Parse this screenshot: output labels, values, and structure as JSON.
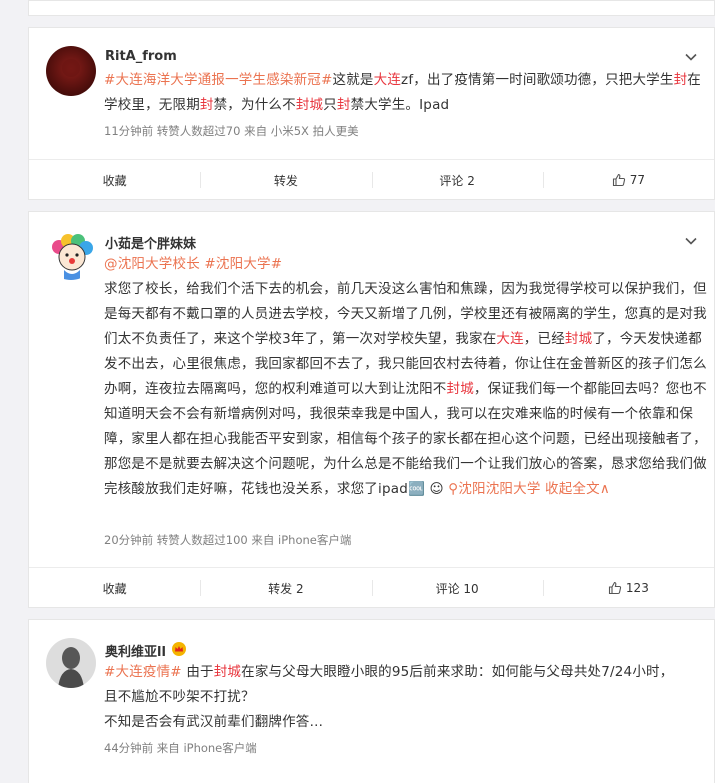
{
  "posts": [
    {
      "username": "RitA_from",
      "segments": [
        {
          "t": "#大连海洋大学通报一学生感染新冠#",
          "c": "topic"
        },
        {
          "t": "这就是",
          "c": ""
        },
        {
          "t": "大连",
          "c": "hl"
        },
        {
          "t": "zf，出了疫情第一时间歌颂功德，只把大学生",
          "c": ""
        },
        {
          "t": "封",
          "c": "hl"
        },
        {
          "t": "在学校里，无限期",
          "c": ""
        },
        {
          "t": "封",
          "c": "hl"
        },
        {
          "t": "禁，为什么不",
          "c": ""
        },
        {
          "t": "封城",
          "c": "hl"
        },
        {
          "t": "只",
          "c": ""
        },
        {
          "t": "封",
          "c": "hl"
        },
        {
          "t": "禁大学生。Ipad",
          "c": ""
        }
      ],
      "meta": "11分钟前 转赞人数超过70  来自 小米5X 拍人更美",
      "actions": {
        "collect": "收藏",
        "repost": "转发",
        "comment": "评论 2",
        "like": "77"
      }
    },
    {
      "username": "小茹是个胖妹妹",
      "segments": [
        {
          "t": "@沈阳大学校长",
          "c": "link"
        },
        {
          "t": " ",
          "c": ""
        },
        {
          "t": "#沈阳大学#",
          "c": "topic"
        },
        {
          "t": "\n",
          "c": ""
        },
        {
          "t": "求您了校长，给我们个活下去的机会，前几天没这么害怕和焦躁，因为我觉得学校可以保护我们，但是每天都有不戴口罩的人员进去学校，今天又新增了几例，学校里还有被隔离的学生，您真的是对我们太不负责任了，来这个学校3年了，第一次对学校失望，我家在",
          "c": ""
        },
        {
          "t": "大连",
          "c": "hl"
        },
        {
          "t": "，已经",
          "c": ""
        },
        {
          "t": "封城",
          "c": "hl"
        },
        {
          "t": "了，今天发快递都发不出去，心里很焦虑，我回家都回不去了，我只能回农村去待着，你让住在金普新区的孩子们怎么办啊，连夜拉去隔离吗，您的权利难道可以大到让沈阳不",
          "c": ""
        },
        {
          "t": "封城",
          "c": "hl"
        },
        {
          "t": "，保证我们每一个都能回去吗？您也不知道明天会不会有新增病例对吗，我很荣幸我是中国人，我可以在灾难来临的时候有一个依靠和保障，家里人都在担心我能否平安到家，相信每个孩子的家长都在担心这个问题，已经出现接触者了，那您是不是就要去解决这个问题呢，为什么总是不能给我们一个让我们放心的答案，恳求您给我们做完核酸放我们走好嘛，花钱也没关系，求您了ipad",
          "c": ""
        },
        {
          "t": "🆒 ☺ ",
          "c": ""
        },
        {
          "t": "⚲沈阳沈阳大学",
          "c": "link"
        },
        {
          "t": " ",
          "c": ""
        },
        {
          "t": "收起全文∧",
          "c": "link"
        }
      ],
      "meta": "20分钟前 转赞人数超过100  来自 iPhone客户端",
      "actions": {
        "collect": "收藏",
        "repost": "转发 2",
        "comment": "评论 10",
        "like": "123"
      }
    },
    {
      "username": "奥利维亚ll",
      "segments": [
        {
          "t": "#大连疫情#",
          "c": "topic"
        },
        {
          "t": " 由于",
          "c": ""
        },
        {
          "t": "封城",
          "c": "hl"
        },
        {
          "t": "在家与父母大眼瞪小眼的95后前来求助：如何能与父母共处7/24小时，\n且不尴尬不吵架不打扰？\n不知是否会有武汉前辈们翻牌作答…",
          "c": ""
        }
      ],
      "meta": "44分钟前 来自 iPhone客户端"
    }
  ],
  "colors": {
    "topic": "#eb7350",
    "highlight": "#e8353d",
    "meta": "#808080"
  }
}
